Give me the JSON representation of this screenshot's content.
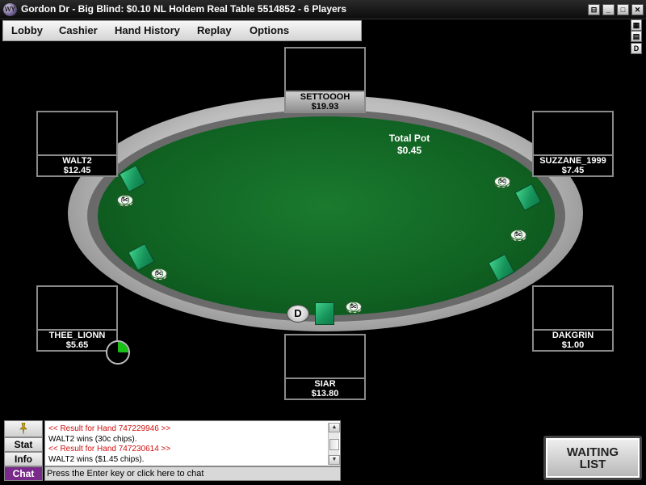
{
  "window": {
    "title": "Gordon Dr - Big Blind: $0.10 NL Holdem Real Table 5514852 - 6 Players",
    "logo_text": "WY",
    "buttons": {
      "restore": "⊟",
      "minimize": "_",
      "maximize": "□",
      "close": "✕"
    }
  },
  "menu": {
    "lobby": "Lobby",
    "cashier": "Cashier",
    "hand_history": "Hand History",
    "replay": "Replay",
    "options": "Options"
  },
  "side_buttons": {
    "layout": "▦",
    "layout2": "▤",
    "dealer_toggle": "D"
  },
  "pot": {
    "label": "Total Pot",
    "amount": "$0.45"
  },
  "seats": {
    "settoooh": {
      "name": "SETTOOOH",
      "stack": "$19.93",
      "active": true
    },
    "walt2": {
      "name": "WALT2",
      "stack": "$12.45"
    },
    "suzzane": {
      "name": "SUZZANE_1999",
      "stack": "$7.45"
    },
    "thee": {
      "name": "THEE_LIONN",
      "stack": "$5.65"
    },
    "dakgrin": {
      "name": "DAKGRIN",
      "stack": "$1.00"
    },
    "siar": {
      "name": "SIAR",
      "stack": "$13.80"
    }
  },
  "chips": {
    "walt2": "5c",
    "thee": "5c",
    "suzzane_a": "5c",
    "suzzane_b": "5c",
    "siar": "5c"
  },
  "dealer_button": "D",
  "timer": {
    "fraction_remaining": 0.25,
    "color": "#18c018"
  },
  "bottom": {
    "tabs": {
      "stat": "Stat",
      "info": "Info",
      "chat": "Chat"
    },
    "chat_log": [
      {
        "text": "<< Result for Hand 747229946 >>",
        "color": "#d01010"
      },
      {
        "text": "WALT2 wins (30c chips).",
        "color": "#000000"
      },
      {
        "text": "<< Result for Hand 747230614 >>",
        "color": "#d01010"
      },
      {
        "text": "WALT2 wins ($1.45 chips).",
        "color": "#000000"
      }
    ],
    "chat_input_placeholder": "Press the Enter key or click here to chat",
    "waiting_list": {
      "line1": "WAITING",
      "line2": "LIST"
    }
  },
  "colors": {
    "felt": "#106222",
    "active_tab": "#7a2a8a",
    "card_back": "#16935a"
  }
}
